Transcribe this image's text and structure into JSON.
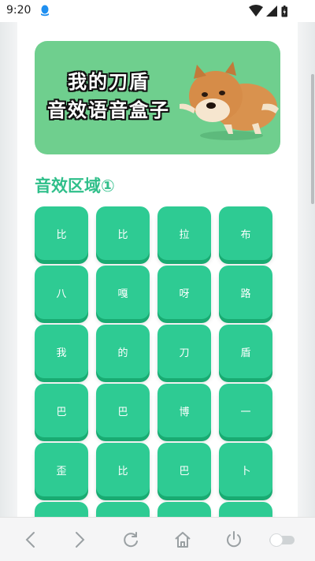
{
  "status_bar": {
    "time": "9:20",
    "icons": [
      "qq-notification-icon",
      "wifi-icon",
      "signal-icon",
      "battery-icon"
    ]
  },
  "banner": {
    "title_line1": "我的刀盾",
    "title_line2": "音效语音盒子",
    "background_color": "#6fcf8e"
  },
  "section": {
    "title": "音效区域①",
    "title_color": "#2fbf8a"
  },
  "buttons": [
    "比",
    "比",
    "拉",
    "布",
    "八",
    "嘎",
    "呀",
    "路",
    "我",
    "的",
    "刀",
    "盾",
    "巴",
    "巴",
    "博",
    "一",
    "歪",
    "比",
    "巴",
    "卜",
    "",
    "",
    "",
    ""
  ],
  "button_color": "#2ecb93",
  "nav_bar": {
    "buttons": [
      "back-icon",
      "forward-icon",
      "refresh-icon",
      "home-icon",
      "power-icon",
      "toggle-switch"
    ]
  }
}
